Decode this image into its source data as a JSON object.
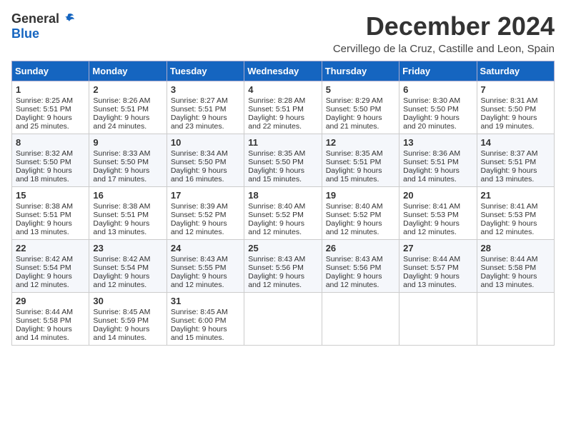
{
  "logo": {
    "general": "General",
    "blue": "Blue"
  },
  "title": "December 2024",
  "location": "Cervillego de la Cruz, Castille and Leon, Spain",
  "weekdays": [
    "Sunday",
    "Monday",
    "Tuesday",
    "Wednesday",
    "Thursday",
    "Friday",
    "Saturday"
  ],
  "weeks": [
    [
      {
        "day": "1",
        "sunrise": "8:25 AM",
        "sunset": "5:51 PM",
        "daylight": "9 hours and 25 minutes."
      },
      {
        "day": "2",
        "sunrise": "8:26 AM",
        "sunset": "5:51 PM",
        "daylight": "9 hours and 24 minutes."
      },
      {
        "day": "3",
        "sunrise": "8:27 AM",
        "sunset": "5:51 PM",
        "daylight": "9 hours and 23 minutes."
      },
      {
        "day": "4",
        "sunrise": "8:28 AM",
        "sunset": "5:51 PM",
        "daylight": "9 hours and 22 minutes."
      },
      {
        "day": "5",
        "sunrise": "8:29 AM",
        "sunset": "5:50 PM",
        "daylight": "9 hours and 21 minutes."
      },
      {
        "day": "6",
        "sunrise": "8:30 AM",
        "sunset": "5:50 PM",
        "daylight": "9 hours and 20 minutes."
      },
      {
        "day": "7",
        "sunrise": "8:31 AM",
        "sunset": "5:50 PM",
        "daylight": "9 hours and 19 minutes."
      }
    ],
    [
      {
        "day": "8",
        "sunrise": "8:32 AM",
        "sunset": "5:50 PM",
        "daylight": "9 hours and 18 minutes."
      },
      {
        "day": "9",
        "sunrise": "8:33 AM",
        "sunset": "5:50 PM",
        "daylight": "9 hours and 17 minutes."
      },
      {
        "day": "10",
        "sunrise": "8:34 AM",
        "sunset": "5:50 PM",
        "daylight": "9 hours and 16 minutes."
      },
      {
        "day": "11",
        "sunrise": "8:35 AM",
        "sunset": "5:50 PM",
        "daylight": "9 hours and 15 minutes."
      },
      {
        "day": "12",
        "sunrise": "8:35 AM",
        "sunset": "5:51 PM",
        "daylight": "9 hours and 15 minutes."
      },
      {
        "day": "13",
        "sunrise": "8:36 AM",
        "sunset": "5:51 PM",
        "daylight": "9 hours and 14 minutes."
      },
      {
        "day": "14",
        "sunrise": "8:37 AM",
        "sunset": "5:51 PM",
        "daylight": "9 hours and 13 minutes."
      }
    ],
    [
      {
        "day": "15",
        "sunrise": "8:38 AM",
        "sunset": "5:51 PM",
        "daylight": "9 hours and 13 minutes."
      },
      {
        "day": "16",
        "sunrise": "8:38 AM",
        "sunset": "5:51 PM",
        "daylight": "9 hours and 13 minutes."
      },
      {
        "day": "17",
        "sunrise": "8:39 AM",
        "sunset": "5:52 PM",
        "daylight": "9 hours and 12 minutes."
      },
      {
        "day": "18",
        "sunrise": "8:40 AM",
        "sunset": "5:52 PM",
        "daylight": "9 hours and 12 minutes."
      },
      {
        "day": "19",
        "sunrise": "8:40 AM",
        "sunset": "5:52 PM",
        "daylight": "9 hours and 12 minutes."
      },
      {
        "day": "20",
        "sunrise": "8:41 AM",
        "sunset": "5:53 PM",
        "daylight": "9 hours and 12 minutes."
      },
      {
        "day": "21",
        "sunrise": "8:41 AM",
        "sunset": "5:53 PM",
        "daylight": "9 hours and 12 minutes."
      }
    ],
    [
      {
        "day": "22",
        "sunrise": "8:42 AM",
        "sunset": "5:54 PM",
        "daylight": "9 hours and 12 minutes."
      },
      {
        "day": "23",
        "sunrise": "8:42 AM",
        "sunset": "5:54 PM",
        "daylight": "9 hours and 12 minutes."
      },
      {
        "day": "24",
        "sunrise": "8:43 AM",
        "sunset": "5:55 PM",
        "daylight": "9 hours and 12 minutes."
      },
      {
        "day": "25",
        "sunrise": "8:43 AM",
        "sunset": "5:56 PM",
        "daylight": "9 hours and 12 minutes."
      },
      {
        "day": "26",
        "sunrise": "8:43 AM",
        "sunset": "5:56 PM",
        "daylight": "9 hours and 12 minutes."
      },
      {
        "day": "27",
        "sunrise": "8:44 AM",
        "sunset": "5:57 PM",
        "daylight": "9 hours and 13 minutes."
      },
      {
        "day": "28",
        "sunrise": "8:44 AM",
        "sunset": "5:58 PM",
        "daylight": "9 hours and 13 minutes."
      }
    ],
    [
      {
        "day": "29",
        "sunrise": "8:44 AM",
        "sunset": "5:58 PM",
        "daylight": "9 hours and 14 minutes."
      },
      {
        "day": "30",
        "sunrise": "8:45 AM",
        "sunset": "5:59 PM",
        "daylight": "9 hours and 14 minutes."
      },
      {
        "day": "31",
        "sunrise": "8:45 AM",
        "sunset": "6:00 PM",
        "daylight": "9 hours and 15 minutes."
      },
      null,
      null,
      null,
      null
    ]
  ]
}
